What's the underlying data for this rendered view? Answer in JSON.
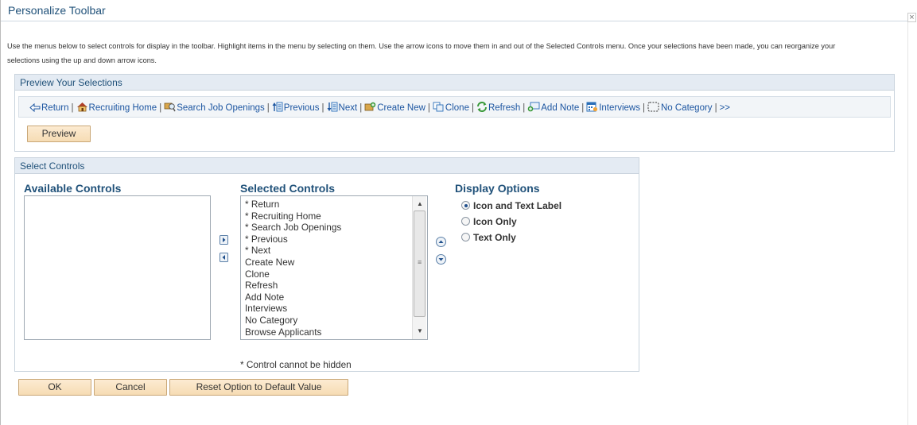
{
  "dialog": {
    "title": "Personalize Toolbar",
    "close_symbol": "×",
    "instructions": "Use the menus below to select controls for display in the toolbar. Highlight items in the menu by selecting on them. Use the arrow icons to move them in and out of the Selected Controls menu. Once your selections have been made, you can reorganize your selections using the up and down arrow icons."
  },
  "preview": {
    "header": "Preview Your Selections",
    "toolbar_items": [
      {
        "label": "Return",
        "icon": "back-arrow-icon"
      },
      {
        "label": "Recruiting Home",
        "icon": "home-icon"
      },
      {
        "label": "Search Job Openings",
        "icon": "search-job-icon"
      },
      {
        "label": "Previous",
        "icon": "previous-icon"
      },
      {
        "label": "Next",
        "icon": "next-icon"
      },
      {
        "label": "Create New",
        "icon": "create-new-icon"
      },
      {
        "label": "Clone",
        "icon": "clone-icon"
      },
      {
        "label": "Refresh",
        "icon": "refresh-icon"
      },
      {
        "label": "Add Note",
        "icon": "add-note-icon"
      },
      {
        "label": "Interviews",
        "icon": "interviews-icon"
      },
      {
        "label": "No Category",
        "icon": "no-category-icon"
      }
    ],
    "separator": "|",
    "more": ">>",
    "button_label": "Preview"
  },
  "controls": {
    "header": "Select Controls",
    "available_label": "Available Controls",
    "available_items": [],
    "selected_label": "Selected Controls",
    "selected_items": [
      "* Return",
      "* Recruiting Home",
      "* Search Job Openings",
      "* Previous",
      "* Next",
      "Create New",
      "Clone",
      "Refresh",
      "Add Note",
      "Interviews",
      "No Category",
      "Browse Applicants"
    ],
    "display_options_label": "Display Options",
    "display_options": [
      {
        "label": "Icon and Text Label",
        "selected": true
      },
      {
        "label": "Icon Only",
        "selected": false
      },
      {
        "label": "Text Only",
        "selected": false
      }
    ],
    "footnote": "* Control cannot be hidden"
  },
  "buttons": {
    "ok": "OK",
    "cancel": "Cancel",
    "reset": "Reset Option to Default Value"
  },
  "colors": {
    "link": "#1d56a1",
    "header_text": "#21527a",
    "button_bg": "#f8e2c2"
  }
}
